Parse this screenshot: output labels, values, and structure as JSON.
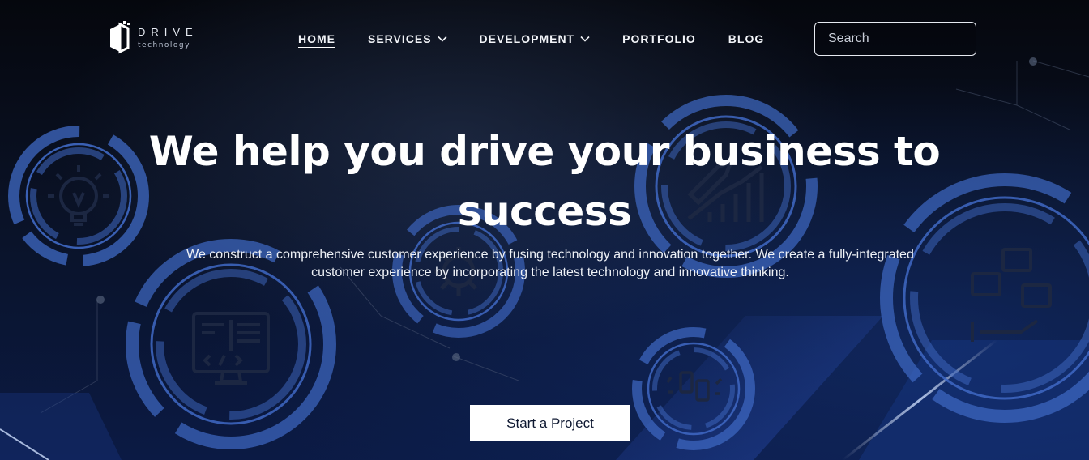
{
  "brand": {
    "name": "DRIVE",
    "tagline": "technology"
  },
  "nav": {
    "items": [
      {
        "label": "HOME",
        "active": true,
        "has_dropdown": false
      },
      {
        "label": "SERVICES",
        "active": false,
        "has_dropdown": true
      },
      {
        "label": "DEVELOPMENT",
        "active": false,
        "has_dropdown": true
      },
      {
        "label": "PORTFOLIO",
        "active": false,
        "has_dropdown": false
      },
      {
        "label": "BLOG",
        "active": false,
        "has_dropdown": false
      }
    ],
    "dropdown_icon": "chevron-down-icon"
  },
  "search": {
    "placeholder": "Search",
    "value": "",
    "icon": "search-icon"
  },
  "hero": {
    "headline": "We help you drive your business to success",
    "subtext": "We construct a comprehensive customer experience by fusing technology and innovation together. We create a fully-integrated customer experience by incorporating the latest technology and innovative thinking.",
    "cta_label": "Start a Project",
    "background_icons": [
      "lightbulb-gear-icon",
      "code-monitor-icon",
      "gear-cog-icon",
      "rocket-growth-icon",
      "money-stack-icon",
      "mobile-payment-icon"
    ]
  },
  "colors": {
    "background": "#030814",
    "accent_ring": "#3a63b8",
    "text": "#ffffff",
    "cta_bg": "#ffffff",
    "cta_text": "#0d1730"
  }
}
